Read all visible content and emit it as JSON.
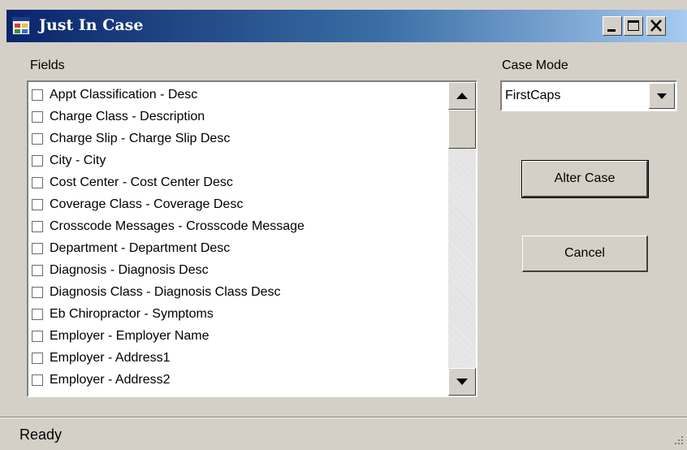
{
  "window": {
    "title": "Just In Case",
    "icons": {
      "app": "form-icon",
      "minimize": "minimize-icon",
      "maximize": "maximize-icon",
      "close": "close-icon"
    }
  },
  "fields": {
    "label": "Fields",
    "items": [
      {
        "label": "Appt Classification - Desc",
        "checked": false
      },
      {
        "label": "Charge Class - Description",
        "checked": false
      },
      {
        "label": "Charge Slip - Charge Slip Desc",
        "checked": false
      },
      {
        "label": "City - City",
        "checked": false
      },
      {
        "label": "Cost Center - Cost Center Desc",
        "checked": false
      },
      {
        "label": "Coverage Class - Coverage Desc",
        "checked": false
      },
      {
        "label": "Crosscode Messages - Crosscode Message",
        "checked": false
      },
      {
        "label": "Department - Department Desc",
        "checked": false
      },
      {
        "label": "Diagnosis - Diagnosis Desc",
        "checked": false
      },
      {
        "label": "Diagnosis Class - Diagnosis Class Desc",
        "checked": false
      },
      {
        "label": "Eb Chiropractor - Symptoms",
        "checked": false
      },
      {
        "label": "Employer - Employer Name",
        "checked": false
      },
      {
        "label": "Employer - Address1",
        "checked": false
      },
      {
        "label": "Employer - Address2",
        "checked": false
      }
    ]
  },
  "case_mode": {
    "label": "Case Mode",
    "value": "FirstCaps"
  },
  "buttons": {
    "alter_case": "Alter Case",
    "cancel": "Cancel"
  },
  "status": {
    "text": "Ready"
  },
  "colors": {
    "titlebar_start": "#0a246a",
    "titlebar_end": "#a6caf0",
    "face": "#d4d0c8"
  }
}
